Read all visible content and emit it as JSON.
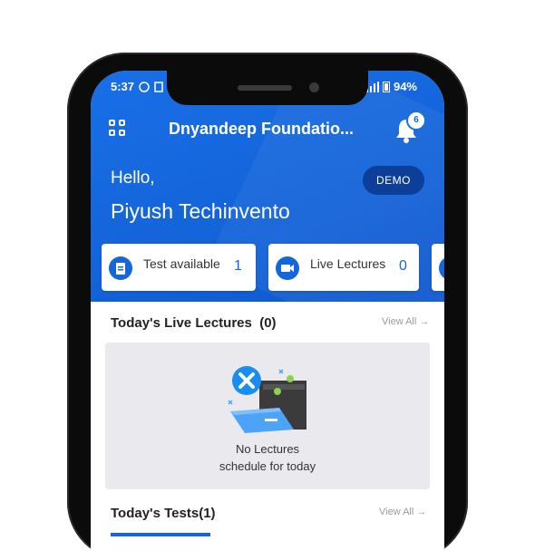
{
  "status_bar": {
    "time": "5:37",
    "battery": "94%"
  },
  "header": {
    "org_name": "Dnyandeep Foundatio...",
    "notification_count": "6"
  },
  "greeting": {
    "hello": "Hello,",
    "user_name": "Piyush Techinvento",
    "mode_badge": "DEMO"
  },
  "stats": [
    {
      "label": "Test available",
      "count": "1"
    },
    {
      "label": "Live Lectures",
      "count": "0"
    }
  ],
  "live_lectures": {
    "title": "Today's Live Lectures",
    "count": "(0)",
    "view_all": "View All →"
  },
  "empty_state": {
    "line1": "No Lectures",
    "line2": "schedule for today"
  },
  "tests": {
    "title": "Today's Tests(1)",
    "view_all": "View All →"
  },
  "colors": {
    "primary": "#1466da",
    "demo_badge": "#0d3f9a"
  }
}
